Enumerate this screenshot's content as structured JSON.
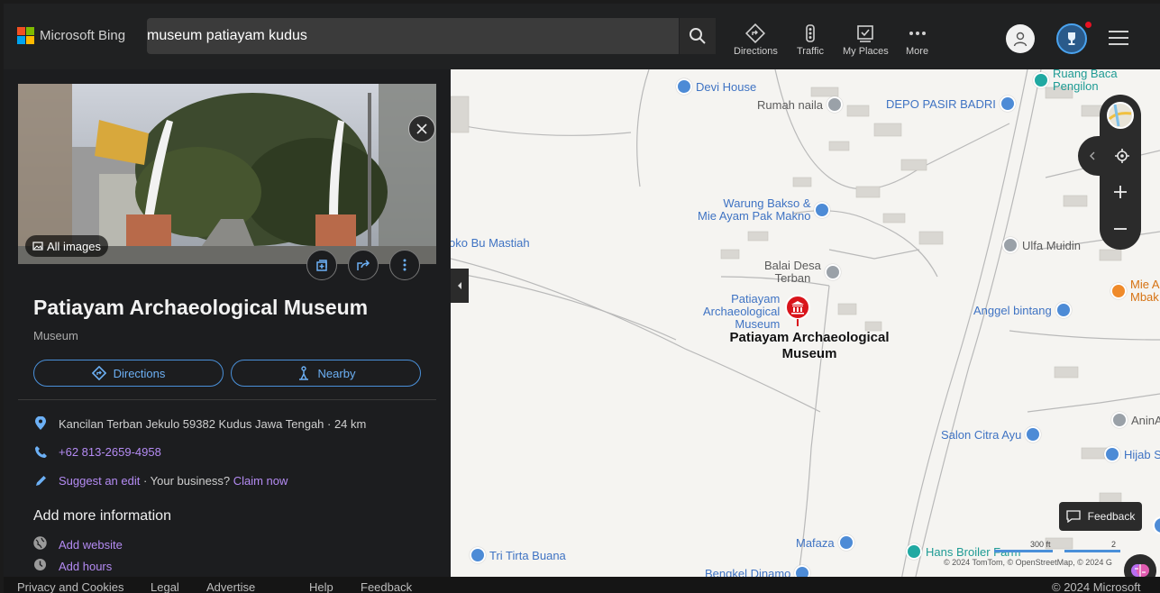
{
  "header": {
    "logo_text": "Microsoft Bing",
    "search_value": "museum patiayam kudus",
    "nav": [
      {
        "label": "Directions",
        "icon": "directions-icon"
      },
      {
        "label": "Traffic",
        "icon": "traffic-icon"
      },
      {
        "label": "My Places",
        "icon": "my-places-icon"
      },
      {
        "label": "More",
        "icon": "more-icon"
      }
    ]
  },
  "panel": {
    "all_images_label": "All images",
    "title": "Patiayam Archaeological Museum",
    "category": "Museum",
    "directions_label": "Directions",
    "nearby_label": "Nearby",
    "address": "Kancilan Terban Jekulo 59382 Kudus Jawa Tengah · 24 km",
    "phone": "+62 813-2659-4958",
    "suggest_edit": "Suggest an edit",
    "your_business": " · Your business? ",
    "claim_now": "Claim now",
    "add_more_title": "Add more information",
    "add_website": "Add website",
    "add_hours": "Add hours"
  },
  "map": {
    "selected_label_line1": "Patiayam Archaeological",
    "selected_label_line2": "Museum",
    "poi_selected_line1": "Patiayam",
    "poi_selected_line2": "Archaeological",
    "poi_selected_line3": "Museum",
    "pois": {
      "devi_house": "Devi House",
      "rumah_naila": "Rumah naila",
      "depo_pasir": "DEPO PASIR BADRI",
      "ruang_baca_1": "Ruang Baca",
      "ruang_baca_2": "Pengilon",
      "warung_1": "Warung Bakso &",
      "warung_2": "Mie Ayam Pak Makno",
      "toko": "oko Bu Mastiah",
      "balai_1": "Balai Desa",
      "balai_2": "Terban",
      "ulfa": "Ulfa Muidin",
      "mie_1": "Mie A",
      "mie_2": "Mbak",
      "anggel": "Anggel bintang",
      "salon": "Salon Citra Ayu",
      "anin": "AninA",
      "hijab": "Hijab S",
      "tri_tirta": "Tri Tirta Buana",
      "mafaza": "Mafaza",
      "hans": "Hans Broiler Farm",
      "bengkel": "Bengkel Dinamo"
    },
    "feedback_label": "Feedback",
    "scale_ft": "300 ft",
    "scale_m": "2",
    "copyright": "© 2024 TomTom, © OpenStreetMap, © 2024 G"
  },
  "footer": {
    "privacy": "Privacy and Cookies",
    "legal": "Legal",
    "advertise": "Advertise",
    "help": "Help",
    "feedback": "Feedback",
    "copyright": "© 2024 Microsoft"
  },
  "colors": {
    "accent_blue": "#4a90d9",
    "link_purple": "#b48bf3",
    "pin_red": "#d9141b"
  }
}
